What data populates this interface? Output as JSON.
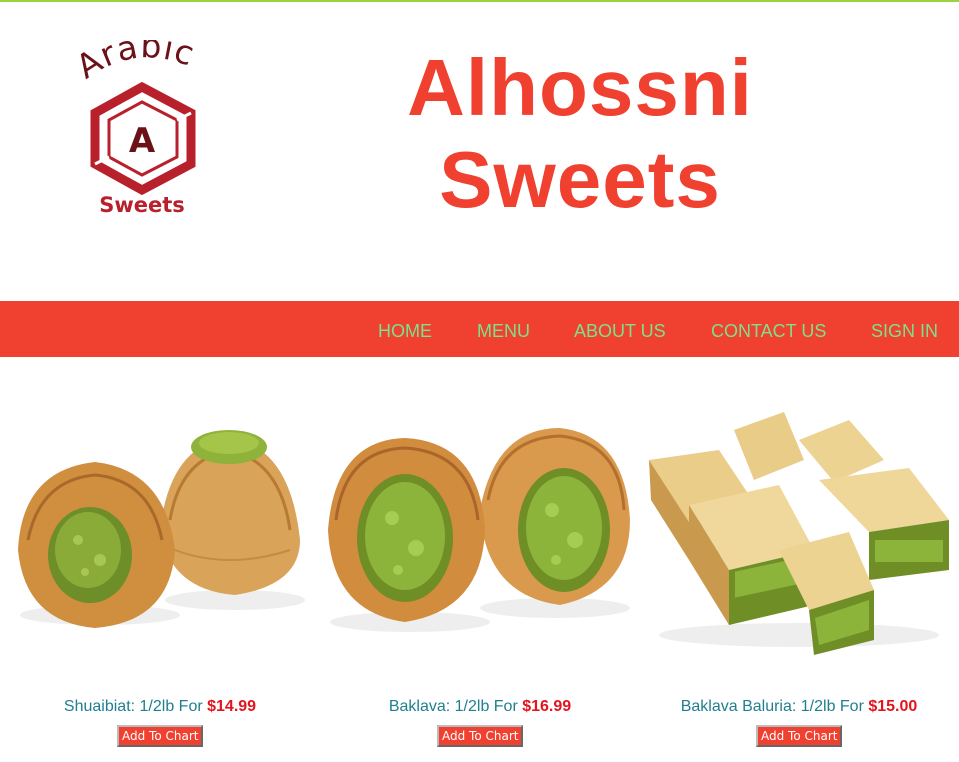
{
  "header": {
    "logo": {
      "top_text": "Arabic",
      "letter": "A",
      "bottom_text": "Sweets"
    },
    "title_line1": "Alhossni",
    "title_line2": "Sweets"
  },
  "colors": {
    "accent": "#f04030",
    "nav_text": "#7ee08a",
    "caption_text": "#1f7f8f",
    "price_text": "#e4141e",
    "top_line": "#9bd33c",
    "logo_dark": "#6b1218",
    "logo_red": "#b8202b"
  },
  "nav": {
    "items": [
      {
        "label": "HOME"
      },
      {
        "label": "MENU"
      },
      {
        "label": "ABOUT US"
      },
      {
        "label": "CONTACT US"
      },
      {
        "label": "SIGN IN"
      }
    ]
  },
  "products": [
    {
      "name": "Shuaibiat: 1/2lb For",
      "price": "$14.99",
      "button": "Add To Chart",
      "image": "shuaibiat-photo"
    },
    {
      "name": "Baklava: 1/2lb For",
      "price": "$16.99",
      "button": "Add To Chart",
      "image": "baklava-photo"
    },
    {
      "name": "Baklava Baluria: 1/2lb For",
      "price": "$15.00",
      "button": "Add To Chart",
      "image": "baklava-baluria-photo"
    }
  ]
}
